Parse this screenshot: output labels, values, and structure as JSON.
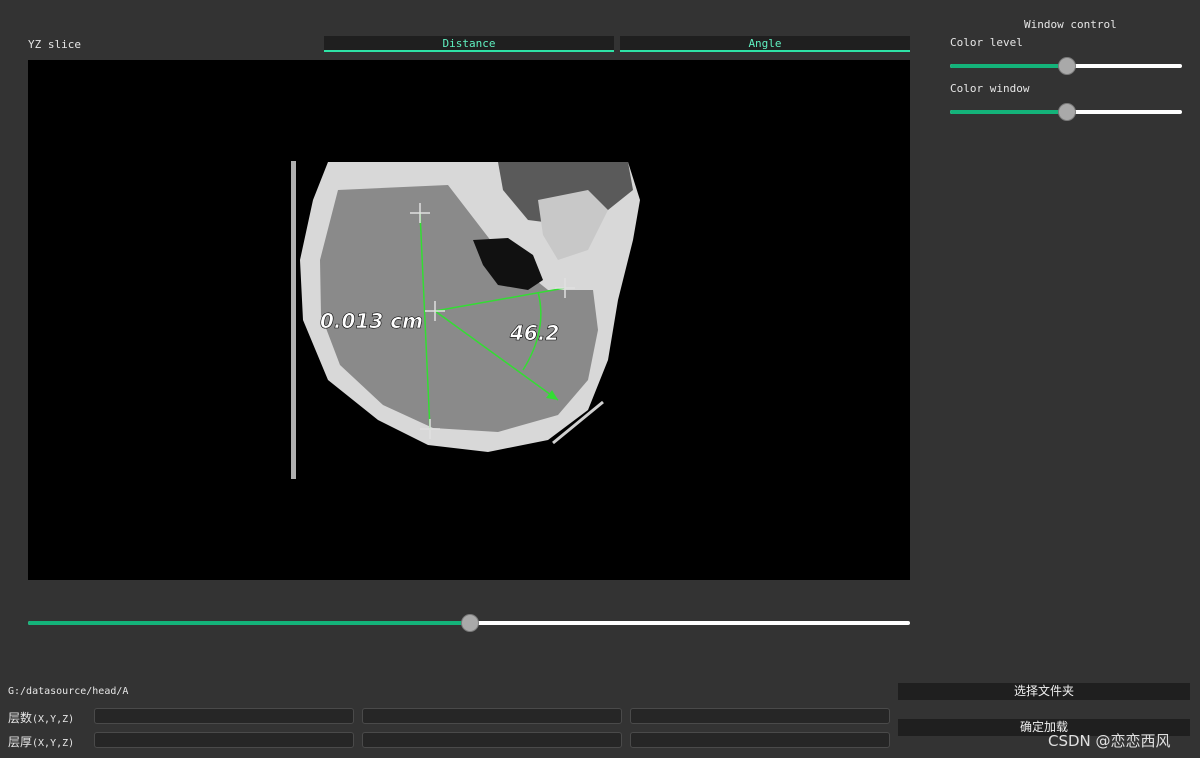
{
  "viewer": {
    "slice_label": "YZ slice",
    "tools": {
      "distance": "Distance",
      "angle": "Angle"
    },
    "annotations": {
      "distance_value": "0.013  cm",
      "angle_value": "46.2"
    },
    "slice_slider_level": 0.5
  },
  "window_control": {
    "title": "Window control",
    "color_level_label": "Color level",
    "color_level_level": 0.5,
    "color_window_label": "Color window",
    "color_window_level": 0.5
  },
  "bottom": {
    "path": "G:/datasource/head/A",
    "layers_label": "层数",
    "layers_suffix": "(X,Y,Z)",
    "thickness_label": "层厚",
    "thickness_suffix": "(X,Y,Z)",
    "select_folder": "选择文件夹",
    "confirm_load": "确定加载"
  },
  "watermark": "CSDN @恋恋西风",
  "colors": {
    "accent": "#14b37a",
    "measure": "#33dd33",
    "tab_text": "#5ff0c0"
  }
}
